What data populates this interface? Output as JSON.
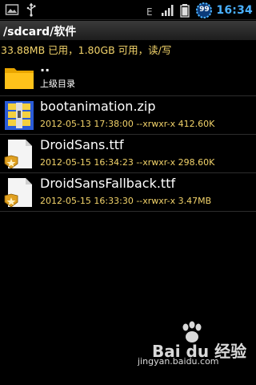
{
  "statusbar": {
    "time": "16:34",
    "badge_count": "99",
    "left_icons": [
      "picture-icon",
      "usb-icon"
    ],
    "right_icons": [
      "e-network-icon",
      "signal-icon",
      "battery-icon"
    ]
  },
  "titlebar": {
    "path": "/sdcard/软件"
  },
  "storage": {
    "text": "33.88MB 已用，1.80GB 可用，读/写"
  },
  "files": [
    {
      "name": "..",
      "meta": "上级目录",
      "icon": "folder-icon",
      "type": "parent"
    },
    {
      "name": "bootanimation.zip",
      "meta": "2012-05-13 17:38:00  --xrwxr-x  412.60K",
      "icon": "zip-archive-icon",
      "type": "file"
    },
    {
      "name": "DroidSans.ttf",
      "meta": "2012-05-15 16:34:23  --xrwxr-x  298.60K",
      "icon": "font-file-icon",
      "type": "file"
    },
    {
      "name": "DroidSansFallback.ttf",
      "meta": "2012-05-15 16:33:30  --xrwxr-x  3.47MB",
      "icon": "font-file-icon",
      "type": "file"
    }
  ],
  "watermark": {
    "brand": "Bai du 经验",
    "url": "jingyan.baidu.com"
  },
  "colors": {
    "accent_time": "#4ab1ff",
    "meta_text": "#f2d36a",
    "background": "#000000"
  }
}
